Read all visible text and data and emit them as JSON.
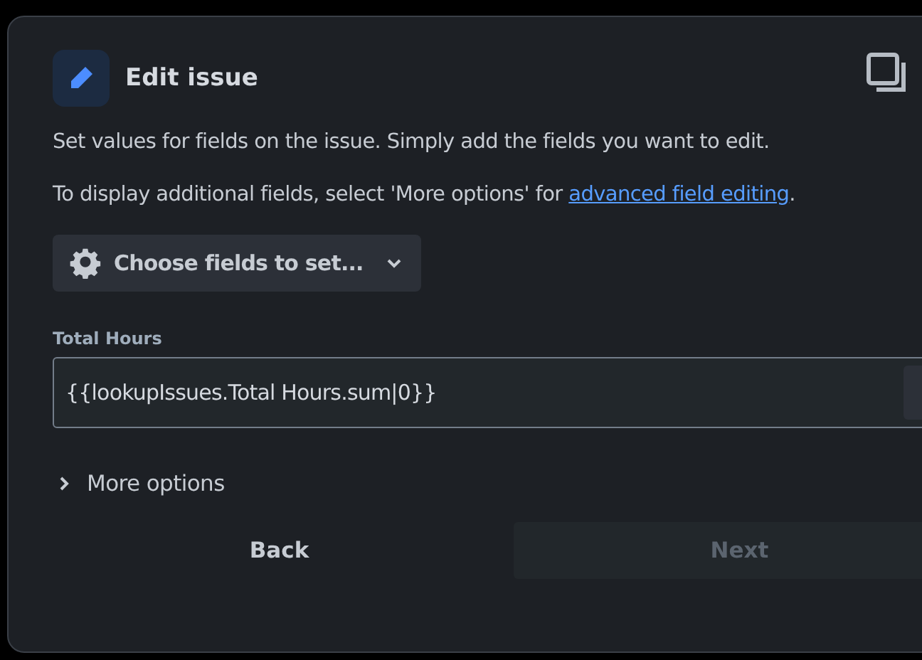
{
  "header": {
    "title": "Edit issue"
  },
  "description": "Set values for fields on the issue. Simply add the fields you want to edit.",
  "note": {
    "text": "To display additional fields, select 'More options' for ",
    "link": "advanced field editing",
    "after": "."
  },
  "choose_button": "Choose fields to set...",
  "field": {
    "label": "Total Hours",
    "value": "{{lookupIssues.Total Hours.sum|0}}"
  },
  "more_options": {
    "label": "More options",
    "expanded": false
  },
  "buttons": [
    {
      "label": "Back",
      "disabled": false
    },
    {
      "label": "Next",
      "disabled": true
    }
  ]
}
